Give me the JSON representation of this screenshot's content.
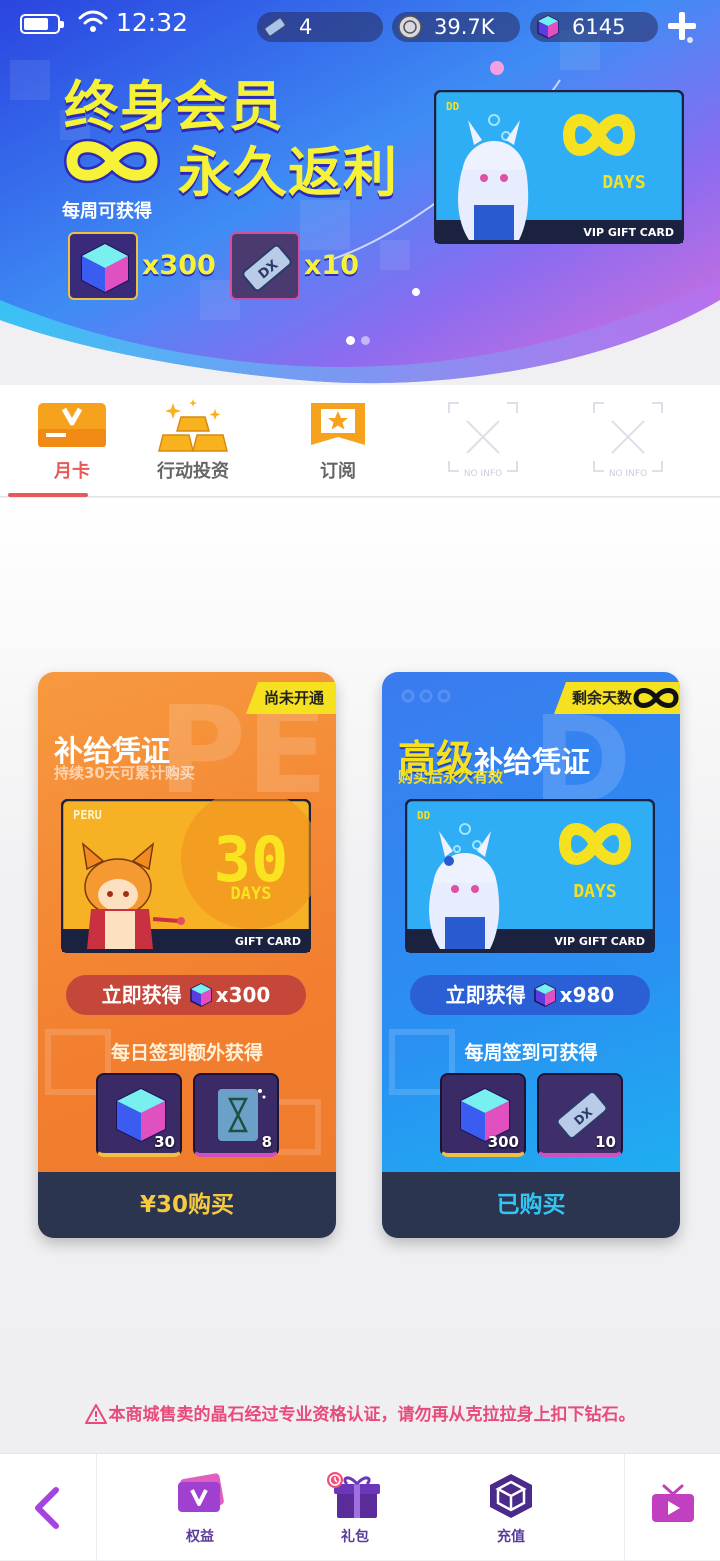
{
  "status_bar": {
    "time": "12:32"
  },
  "currencies": [
    {
      "icon": "ticket-icon",
      "value": "4"
    },
    {
      "icon": "coin-icon",
      "value": "39.7K"
    },
    {
      "icon": "cube-gem-icon",
      "value": "6145"
    }
  ],
  "banner": {
    "title_line1": "终身会员",
    "title_line2": "永久返利",
    "weekly_label": "每周可获得",
    "rewards": [
      {
        "icon": "cube-gem-icon",
        "count": "x300"
      },
      {
        "icon": "ticket-icon",
        "count": "x10"
      }
    ],
    "card": {
      "corner": "DD",
      "days": "DAYS",
      "footer": "VIP GIFT CARD"
    },
    "pages": 2,
    "active_page": 1
  },
  "tabs": [
    {
      "label": "月卡",
      "active": true
    },
    {
      "label": "行动投资",
      "active": false
    },
    {
      "label": "订阅",
      "active": false
    },
    {
      "label": "",
      "placeholder": "NO INFO",
      "active": false
    },
    {
      "label": "",
      "placeholder": "NO INFO",
      "active": false
    }
  ],
  "cards": [
    {
      "ribbon": "尚未开通",
      "title": "补给凭证",
      "subtitle": "持续30天可累计购买",
      "gift_card": {
        "corner": "PERU",
        "number": "30",
        "days": "DAYS",
        "footer": "GIFT CARD"
      },
      "instant_label": "立即获得",
      "instant_count": "x300",
      "bonus_label": "每日签到额外获得",
      "items": [
        {
          "icon": "cube-gem-icon",
          "count": "30"
        },
        {
          "icon": "hourglass-card-icon",
          "count": "8"
        }
      ],
      "button": "¥30购买"
    },
    {
      "ribbon": "剩余天数",
      "title_highlight": "高级",
      "title": "补给凭证",
      "subtitle": "购买后永久有效",
      "gift_card": {
        "corner": "DD",
        "days": "DAYS",
        "footer": "VIP GIFT CARD"
      },
      "instant_label": "立即获得",
      "instant_count": "x980",
      "bonus_label": "每周签到可获得",
      "items": [
        {
          "icon": "cube-gem-icon",
          "count": "300"
        },
        {
          "icon": "ticket-icon",
          "count": "10"
        }
      ],
      "button": "已购买"
    }
  ],
  "warning": "本商城售卖的晶石经过专业资格认证，请勿再从克拉拉身上扣下钻石。",
  "bottom_nav": [
    {
      "icon": "v-badge-icon",
      "label": "权益"
    },
    {
      "icon": "gift-icon",
      "label": "礼包"
    },
    {
      "icon": "cube-icon",
      "label": "充值"
    }
  ],
  "colors": {
    "accent": "#e8585a",
    "orange_card": "#f27f2f",
    "blue_card": "#2a8ff2",
    "nav_purple": "#5b3b9a",
    "ribbon": "#f5e11f"
  }
}
